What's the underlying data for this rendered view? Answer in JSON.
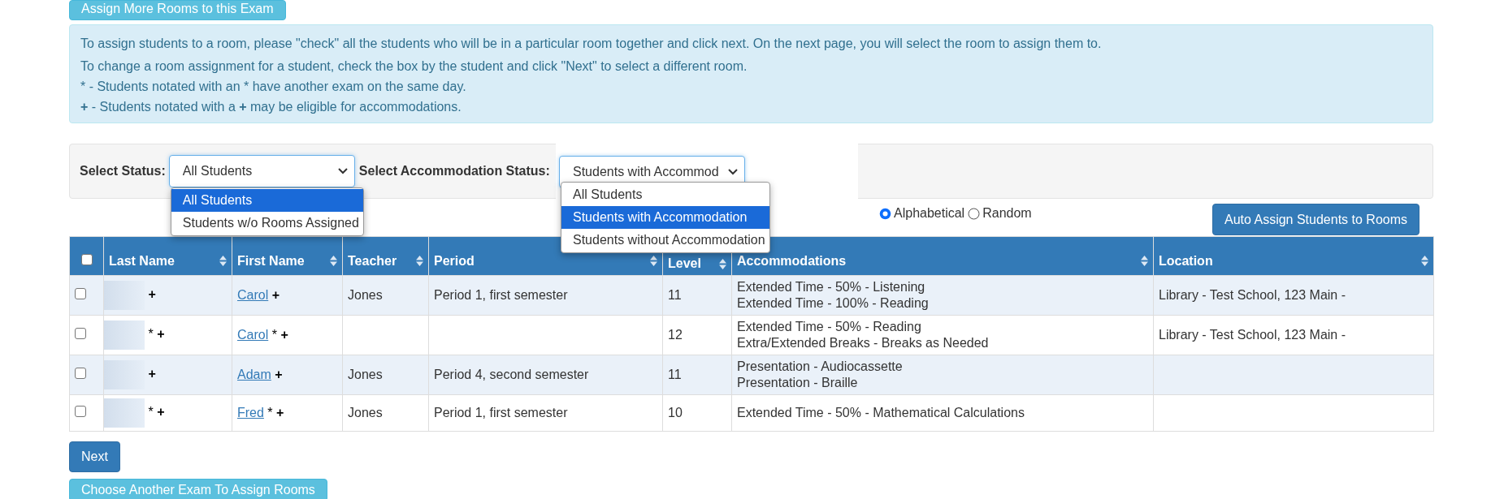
{
  "top_button": "Assign More Rooms to this Exam",
  "info": {
    "lines": [
      {
        "kind": "plain",
        "text": "To assign students to a room, please \"check\" all the students who will be in a particular room together and click next. On the next page, you will select the room to assign them to."
      },
      {
        "kind": "plain",
        "text": "To change a room assignment for a student, check the box by the student and click \"Next\" to select a different room."
      },
      {
        "kind": "plain",
        "text": "* - Students notated with an * have another exam on the same day."
      },
      {
        "kind": "rich",
        "text": "**+** - Students notated with a **+** may be eligible for accommodations."
      }
    ]
  },
  "filters": {
    "status": {
      "label": "Select Status:",
      "value": "All Students",
      "options": [
        {
          "label": "All Students",
          "selected": true
        },
        {
          "label": "Students w/o Rooms Assigned",
          "selected": false
        }
      ]
    },
    "accommodation": {
      "label": "Select Accommodation Status:",
      "value": "Students with Accommod",
      "options": [
        {
          "label": "All Students",
          "selected": false
        },
        {
          "label": "Students with Accommodation",
          "selected": true
        },
        {
          "label": "Students without Accommodation",
          "selected": false
        }
      ]
    }
  },
  "sort_options": [
    {
      "label": "Alphabetical",
      "selected": true
    },
    {
      "label": "Random",
      "selected": false
    }
  ],
  "auto_assign_button": "Auto Assign Students to Rooms",
  "table": {
    "select_all_checked": false,
    "columns": [
      {
        "label": "Last Name",
        "sortable": true
      },
      {
        "label": "First Name",
        "sortable": true
      },
      {
        "label": "Teacher",
        "sortable": true
      },
      {
        "label": "Period",
        "sortable": true
      },
      {
        "label": "Level",
        "sortable": true
      },
      {
        "label": "Accommodations",
        "sortable": true
      },
      {
        "label": "Location",
        "sortable": true
      }
    ],
    "rows": [
      {
        "checked": false,
        "last_name_marks": [
          {
            "kind": "accommodation",
            "symbol": "+"
          }
        ],
        "first_name": "Carol",
        "first_name_marks": [
          {
            "kind": "accommodation",
            "symbol": "+"
          }
        ],
        "teacher": "Jones",
        "period": "Period 1, first semester",
        "level": "11",
        "accommodations": [
          "Extended Time - 50% - Listening",
          "Extended Time - 100% - Reading"
        ],
        "location": "Library - Test School, 123 Main -"
      },
      {
        "checked": false,
        "last_name_marks": [
          {
            "kind": "exam",
            "symbol": "*"
          },
          {
            "kind": "accommodation",
            "symbol": "+"
          }
        ],
        "first_name": "Carol",
        "first_name_marks": [
          {
            "kind": "exam",
            "symbol": "*"
          },
          {
            "kind": "accommodation",
            "symbol": "+"
          }
        ],
        "teacher": "",
        "period": "",
        "level": "12",
        "accommodations": [
          "Extended Time - 50% - Reading",
          "Extra/Extended Breaks - Breaks as Needed"
        ],
        "location": "Library - Test School, 123 Main -"
      },
      {
        "checked": false,
        "last_name_marks": [
          {
            "kind": "accommodation",
            "symbol": "+"
          }
        ],
        "first_name": "Adam",
        "first_name_marks": [
          {
            "kind": "accommodation",
            "symbol": "+"
          }
        ],
        "teacher": "Jones",
        "period": "Period 4, second semester",
        "level": "11",
        "accommodations": [
          "Presentation - Audiocassette",
          "Presentation - Braille"
        ],
        "location": ""
      },
      {
        "checked": false,
        "last_name_marks": [
          {
            "kind": "exam",
            "symbol": "*"
          },
          {
            "kind": "accommodation",
            "symbol": "+"
          }
        ],
        "first_name": "Fred",
        "first_name_marks": [
          {
            "kind": "exam",
            "symbol": "*"
          },
          {
            "kind": "accommodation",
            "symbol": "+"
          }
        ],
        "teacher": "Jones",
        "period": "Period 1, first semester",
        "level": "10",
        "accommodations": [
          "Extended Time - 50% - Mathematical Calculations"
        ],
        "location": ""
      }
    ]
  },
  "next_button": "Next",
  "bottom_button": "Choose Another Exam To Assign Rooms"
}
